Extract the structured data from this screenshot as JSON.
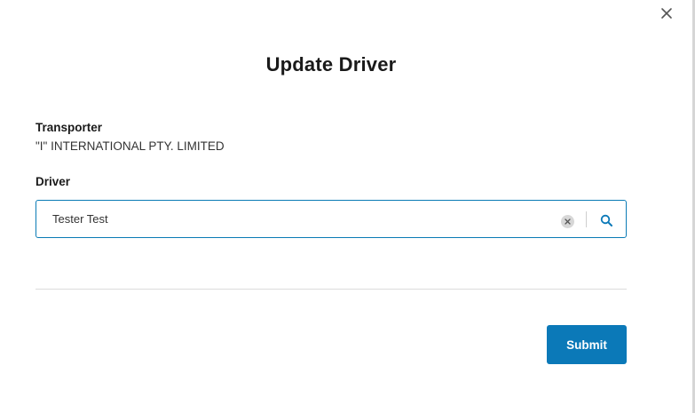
{
  "modal": {
    "title": "Update Driver",
    "close_icon": "close-icon"
  },
  "transporter": {
    "label": "Transporter",
    "value": "\"I\" INTERNATIONAL PTY. LIMITED"
  },
  "driver": {
    "label": "Driver",
    "value": "Tester Test",
    "clear_icon": "clear-x-icon",
    "search_icon": "search-icon"
  },
  "actions": {
    "submit_label": "Submit"
  },
  "colors": {
    "accent": "#0b79b8",
    "field_border": "#0a7bb5",
    "divider": "#dcdcdc"
  }
}
